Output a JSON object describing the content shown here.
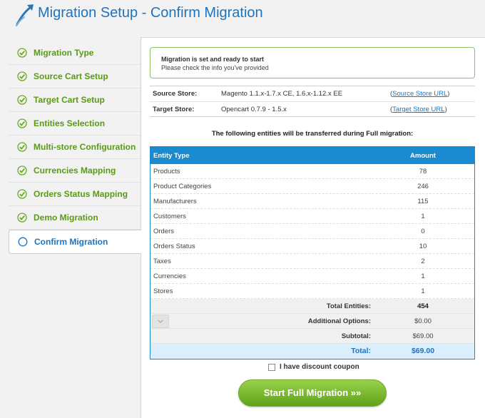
{
  "header": {
    "title": "Migration Setup - Confirm Migration"
  },
  "sidebar": {
    "items": [
      {
        "label": "Migration Type"
      },
      {
        "label": "Source Cart Setup"
      },
      {
        "label": "Target Cart Setup"
      },
      {
        "label": "Entities Selection"
      },
      {
        "label": "Multi-store Configuration"
      },
      {
        "label": "Currencies Mapping"
      },
      {
        "label": "Orders Status Mapping"
      },
      {
        "label": "Demo Migration"
      },
      {
        "label": "Confirm Migration"
      }
    ]
  },
  "notice": {
    "title": "Migration is set and ready to start",
    "subtitle": "Please check the info you've provided"
  },
  "stores": {
    "source": {
      "label": "Source Store:",
      "value": "Magento 1.1.x-1.7.x CE, 1.6.x-1.12.x EE",
      "link": "Source Store URL"
    },
    "target": {
      "label": "Target Store:",
      "value": "Opencart 0.7.9 - 1.5.x",
      "link": "Target Store URL"
    }
  },
  "entities_heading": "The following entities will be transferred during Full migration:",
  "table": {
    "columns": [
      "Entity Type",
      "Amount"
    ],
    "rows": [
      {
        "name": "Products",
        "amount": "78"
      },
      {
        "name": "Product Categories",
        "amount": "246"
      },
      {
        "name": "Manufacturers",
        "amount": "115"
      },
      {
        "name": "Customers",
        "amount": "1"
      },
      {
        "name": "Orders",
        "amount": "0"
      },
      {
        "name": "Orders Status",
        "amount": "10"
      },
      {
        "name": "Taxes",
        "amount": "2"
      },
      {
        "name": "Currencies",
        "amount": "1"
      },
      {
        "name": "Stores",
        "amount": "1"
      }
    ],
    "summary": {
      "total_entities": {
        "label": "Total Entities:",
        "value": "454"
      },
      "additional_options": {
        "label": "Additional Options:",
        "value": "$0.00"
      },
      "subtotal": {
        "label": "Subtotal:",
        "value": "$69.00"
      },
      "total": {
        "label": "Total:",
        "value": "$69.00"
      }
    }
  },
  "coupon_label": "I have discount coupon",
  "start_button": "Start Full Migration »»",
  "colors": {
    "accent_blue": "#1e73be",
    "table_header": "#1a8bd0",
    "completed_green": "#5a9a16",
    "button_green": "#6cb023"
  },
  "icons": {
    "completed_step": "check-circle-icon",
    "current_step": "circle-icon",
    "options_toggle": "chevron-down-icon"
  }
}
